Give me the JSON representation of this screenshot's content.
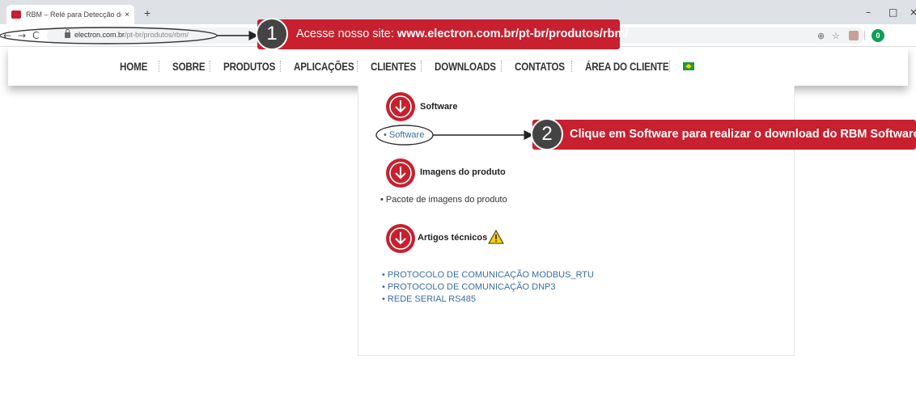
{
  "browser": {
    "tab_title": "RBM – Relé para Detecção de R...",
    "tab_close": "×",
    "new_tab": "+",
    "url_host": "electron.com.br",
    "url_path": "/pt-br/produtos/rbm/",
    "nav": {
      "back": "←",
      "forward": "→",
      "reload": "C"
    },
    "toolbar_icons": {
      "zoom": "⊕",
      "star": "☆"
    },
    "extension_badge": "0",
    "window_controls": {
      "minimize": "–",
      "restore": "□",
      "close": "×"
    }
  },
  "site_nav": {
    "items": [
      "HOME",
      "SOBRE",
      "PRODUTOS",
      "APLICAÇÕES",
      "CLIENTES",
      "DOWNLOADS",
      "CONTATOS",
      "ÁREA DO CLIENTE"
    ],
    "flag_icon": "brazil-flag-icon"
  },
  "downloads": {
    "software": {
      "title": "Software",
      "links": [
        "• Software"
      ]
    },
    "images": {
      "title": "Imagens do produto",
      "items": [
        "• Pacote de imagens do produto"
      ]
    },
    "articles": {
      "title": "Artigos técnicos",
      "warning_icon": "warning-icon",
      "links": [
        "• PROTOCOLO DE COMUNICAÇÃO MODBUS_RTU",
        "• PROTOCOLO DE COMUNICAÇÃO DNP3",
        "• REDE SERIAL RS485"
      ]
    }
  },
  "annotations": {
    "step1": {
      "number": "1",
      "prefix": "Acesse nosso site: ",
      "highlight": "www.electron.com.br/pt-br/produtos/rbm/"
    },
    "step2": {
      "number": "2",
      "text": "Clique em Software para realizar o download do RBM Software"
    }
  },
  "colors": {
    "accent": "#c8202e",
    "link": "#3a6ea5"
  }
}
